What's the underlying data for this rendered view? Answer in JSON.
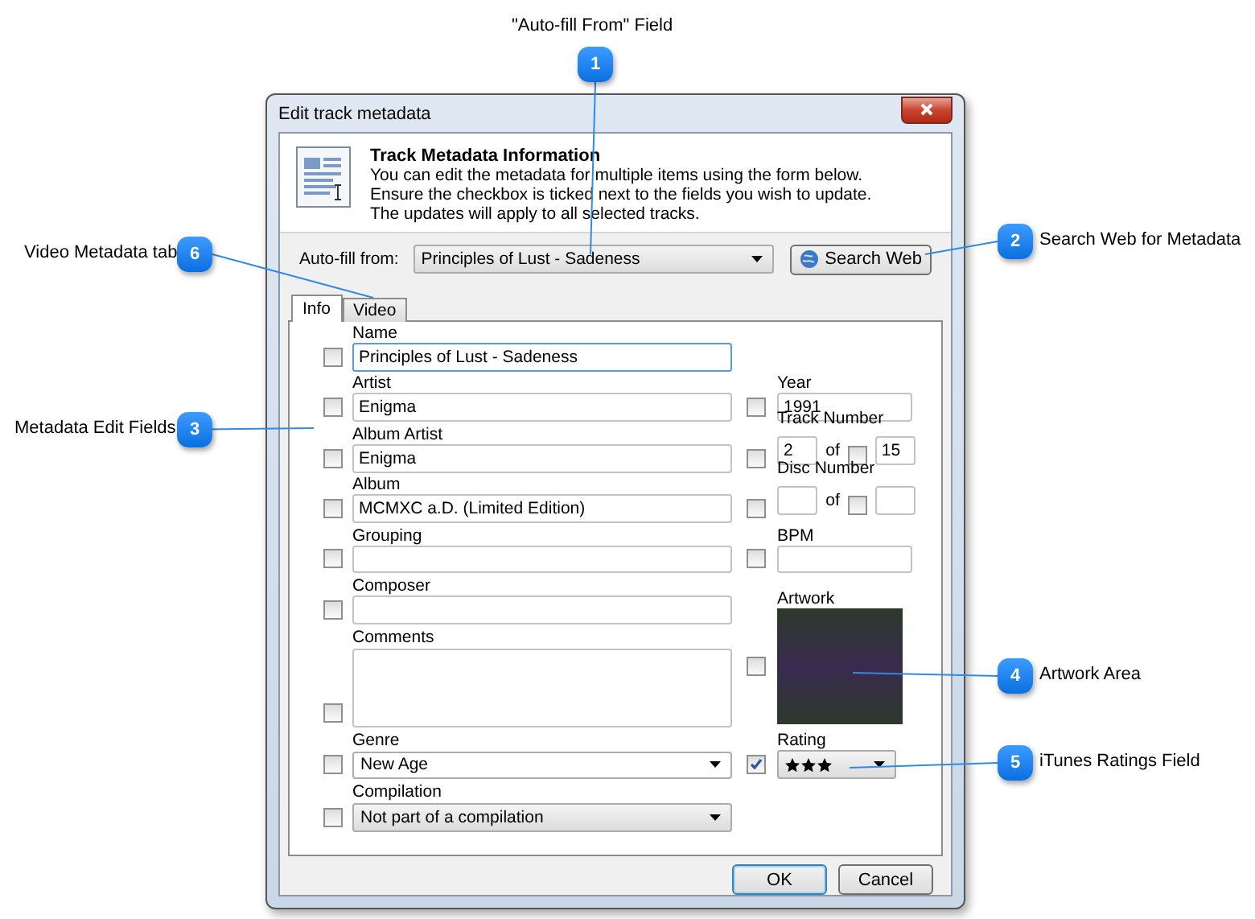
{
  "window": {
    "title": "Edit track metadata"
  },
  "header": {
    "title": "Track Metadata Information",
    "description": "You can edit the metadata for multiple items using the form below.  Ensure the checkbox is ticked next to the fields you wish to update.  The updates will apply to all selected tracks."
  },
  "autofill": {
    "label": "Auto-fill from:",
    "value": "Principles of Lust - Sadeness"
  },
  "search_button": {
    "label": "Search Web"
  },
  "tabs": [
    {
      "label": "Info",
      "selected": true
    },
    {
      "label": "Video",
      "selected": false
    }
  ],
  "left_fields": [
    {
      "kind": "text",
      "label": "Name",
      "value": "Principles of Lust - Sadeness",
      "checked": false,
      "focused": true
    },
    {
      "kind": "text",
      "label": "Artist",
      "value": "Enigma",
      "checked": false,
      "focused": false
    },
    {
      "kind": "text",
      "label": "Album Artist",
      "value": "Enigma",
      "checked": false,
      "focused": false
    },
    {
      "kind": "text",
      "label": "Album",
      "value": "MCMXC a.D. (Limited Edition)",
      "checked": false,
      "focused": false
    },
    {
      "kind": "text",
      "label": "Grouping",
      "checked": false,
      "focused": false
    },
    {
      "kind": "text",
      "label": "Composer",
      "checked": false,
      "focused": false
    },
    {
      "kind": "textarea",
      "label": "Comments",
      "checked": false,
      "focused": false
    },
    {
      "kind": "combo",
      "label": "Genre",
      "value": "New Age",
      "checked": false,
      "focused": false
    },
    {
      "kind": "select",
      "label": "Compilation",
      "value": "Not part of a compilation",
      "checked": false,
      "focused": false
    }
  ],
  "right_fields": [
    {
      "kind": "text",
      "label": "Year",
      "value": "1991",
      "checked": false
    },
    {
      "kind": "pair",
      "label": "Track Number",
      "value": "2",
      "of_label": "of",
      "of_checked": false,
      "of_value": "15",
      "checked": false
    },
    {
      "kind": "pair",
      "label": "Disc Number",
      "of_label": "of",
      "of_checked": false,
      "checked": false
    },
    {
      "kind": "text",
      "label": "BPM",
      "checked": false
    },
    {
      "kind": "artwork",
      "label": "Artwork",
      "checked": false
    },
    {
      "kind": "rating",
      "label": "Rating",
      "stars": 3,
      "checked": true
    }
  ],
  "buttons": [
    {
      "label": "OK",
      "default": true
    },
    {
      "label": "Cancel",
      "default": false
    }
  ],
  "callouts": [
    {
      "number": "1",
      "label": "\"Auto-fill From\" Field"
    },
    {
      "number": "2",
      "label": "Search Web for Metadata"
    },
    {
      "number": "3",
      "label": "Metadata Edit Fields"
    },
    {
      "number": "4",
      "label": "Artwork Area"
    },
    {
      "number": "5",
      "label": "iTunes Ratings Field"
    },
    {
      "number": "6",
      "label": "Video Metadata tab"
    }
  ]
}
